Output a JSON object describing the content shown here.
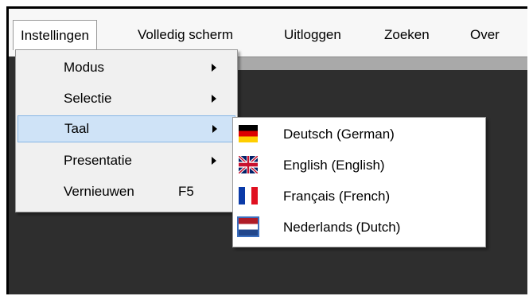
{
  "menubar": {
    "items": [
      {
        "label": "Instellingen"
      },
      {
        "label": "Volledig scherm"
      },
      {
        "label": "Uitloggen"
      },
      {
        "label": "Zoeken"
      },
      {
        "label": "Over"
      }
    ]
  },
  "dropdown": {
    "items": [
      {
        "label": "Modus",
        "has_submenu": true
      },
      {
        "label": "Selectie",
        "has_submenu": true
      },
      {
        "label": "Taal",
        "has_submenu": true,
        "highlighted": true
      },
      {
        "label": "Presentatie",
        "has_submenu": true
      },
      {
        "label": "Vernieuwen",
        "shortcut": "F5"
      }
    ]
  },
  "language_submenu": {
    "items": [
      {
        "label": "Deutsch (German)",
        "icon": "german-flag-icon"
      },
      {
        "label": "English (English)",
        "icon": "uk-flag-icon"
      },
      {
        "label": "Français (French)",
        "icon": "french-flag-icon"
      },
      {
        "label": "Nederlands (Dutch)",
        "icon": "dutch-flag-icon"
      }
    ]
  },
  "colors": {
    "menubar_bg": "#f7f7f7",
    "window_bg": "#2e2e2e",
    "highlight_bg": "#cfe3f7",
    "highlight_border": "#86b6e6"
  }
}
